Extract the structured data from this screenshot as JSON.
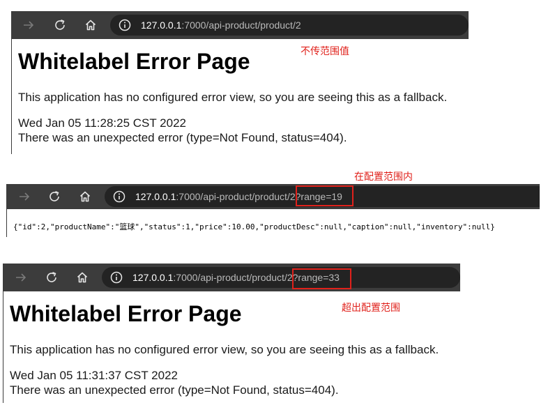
{
  "icons": [
    "forward-arrow-icon",
    "reload-icon",
    "home-icon",
    "info-icon"
  ],
  "colors": {
    "toolbar": "#3c3c3c",
    "url_pill": "#232323",
    "annotation": "#e0211b"
  },
  "panel1": {
    "url_host": "127.0.0.1",
    "url_path": ":7000/api-product/product/2",
    "note": "不传范围值",
    "title": "Whitelabel Error Page",
    "desc": "This application has no configured error view, so you are seeing this as a fallback.",
    "date": "Wed Jan 05 11:28:25 CST 2022",
    "detail": "There was an unexpected error (type=Not Found, status=404)."
  },
  "panel2": {
    "url_host": "127.0.0.1",
    "url_path": ":7000/api-product/product/2?range=19",
    "note": "在配置范围内",
    "json": "{\"id\":2,\"productName\":\"篮球\",\"status\":1,\"price\":10.00,\"productDesc\":null,\"caption\":null,\"inventory\":null}"
  },
  "panel3": {
    "url_host": "127.0.0.1",
    "url_path": ":7000/api-product/product/2?range=33",
    "note": "超出配置范围",
    "title": "Whitelabel Error Page",
    "desc": "This application has no configured error view, so you are seeing this as a fallback.",
    "date": "Wed Jan 05 11:31:37 CST 2022",
    "detail": "There was an unexpected error (type=Not Found, status=404)."
  }
}
